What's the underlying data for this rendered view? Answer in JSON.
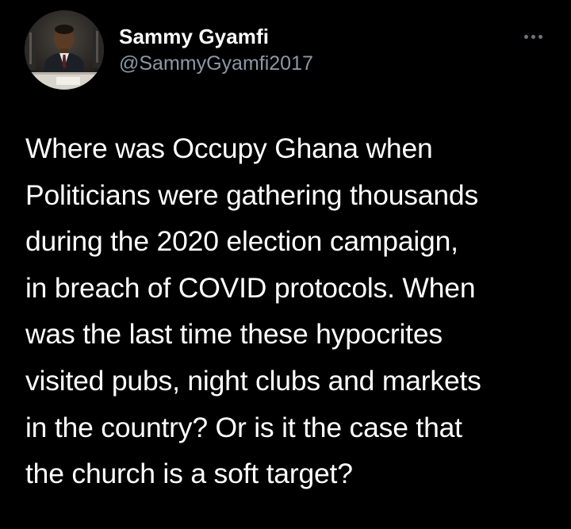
{
  "tweet": {
    "author": {
      "display_name": "Sammy Gyamfi",
      "handle": "@SammyGyamfi2017",
      "avatar_icon": "profile-photo"
    },
    "more_icon": "more-options-icon",
    "text_lines": [
      "Where was Occupy Ghana when",
      "Politicians were gathering thousands",
      "during the 2020 election campaign,",
      "in breach of COVID protocols. When",
      "was the last time these hypocrites",
      "visited pubs, night clubs and markets",
      "in the country? Or is it the case that",
      "the church is a soft target?"
    ]
  },
  "colors": {
    "background": "#000000",
    "text_primary": "#ffffff",
    "text_secondary": "#8b98a5",
    "icon_muted": "#6e767d"
  }
}
